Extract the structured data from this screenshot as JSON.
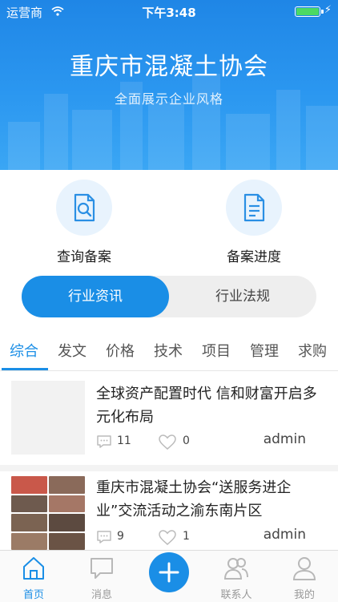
{
  "status_bar": {
    "carrier": "运营商",
    "time": "下午3:48"
  },
  "hero": {
    "title": "重庆市混凝土协会",
    "subtitle": "全面展示企业风格"
  },
  "quick_actions": [
    {
      "label": "查询备案",
      "icon": "search-document-icon"
    },
    {
      "label": "备案进度",
      "icon": "document-list-icon"
    }
  ],
  "segment": {
    "active": "行业资讯",
    "inactive": "行业法规"
  },
  "categories": [
    "综合",
    "发文",
    "价格",
    "技术",
    "项目",
    "管理",
    "求购"
  ],
  "news": [
    {
      "title": "全球资产配置时代 信和财富开启多元化布局",
      "comments": "11",
      "likes": "0",
      "author": "admin"
    },
    {
      "title": "重庆市混凝土协会“送服务进企业”交流活动之渝东南片区",
      "comments": "9",
      "likes": "1",
      "author": "admin"
    }
  ],
  "tabbar": {
    "home": "首页",
    "messages": "消息",
    "contacts": "联系人",
    "mine": "我的"
  },
  "colors": {
    "accent": "#1a8ee6",
    "hero": "#2b97f0"
  }
}
